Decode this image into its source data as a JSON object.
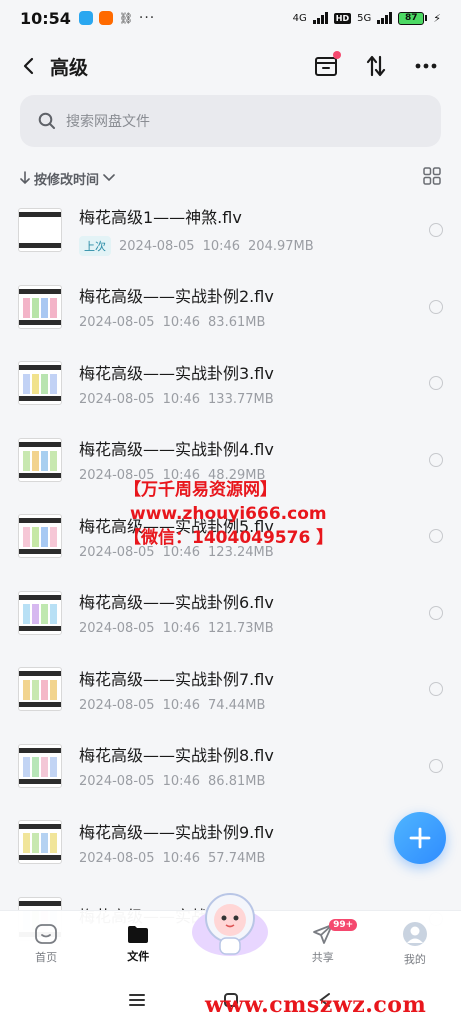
{
  "status_bar": {
    "time": "10:54",
    "network_1": "4G",
    "hd": "HD",
    "network_2": "5G",
    "battery": "87"
  },
  "header": {
    "title": "高级"
  },
  "search": {
    "placeholder": "搜索网盘文件"
  },
  "sort": {
    "label": "按修改时间"
  },
  "files": [
    {
      "name": "梅花高级1——神煞.flv",
      "badge": "上次",
      "date": "2024-08-05",
      "time": "10:46",
      "size": "204.97MB"
    },
    {
      "name": "梅花高级——实战卦例2.flv",
      "badge": "",
      "date": "2024-08-05",
      "time": "10:46",
      "size": "83.61MB"
    },
    {
      "name": "梅花高级——实战卦例3.flv",
      "badge": "",
      "date": "2024-08-05",
      "time": "10:46",
      "size": "133.77MB"
    },
    {
      "name": "梅花高级——实战卦例4.flv",
      "badge": "",
      "date": "2024-08-05",
      "time": "10:46",
      "size": "48.29MB"
    },
    {
      "name": "梅花高级——实战卦例5.flv",
      "badge": "",
      "date": "2024-08-05",
      "time": "10:46",
      "size": "123.24MB"
    },
    {
      "name": "梅花高级——实战卦例6.flv",
      "badge": "",
      "date": "2024-08-05",
      "time": "10:46",
      "size": "121.73MB"
    },
    {
      "name": "梅花高级——实战卦例7.flv",
      "badge": "",
      "date": "2024-08-05",
      "time": "10:46",
      "size": "74.44MB"
    },
    {
      "name": "梅花高级——实战卦例8.flv",
      "badge": "",
      "date": "2024-08-05",
      "time": "10:46",
      "size": "86.81MB"
    },
    {
      "name": "梅花高级——实战卦例9.flv",
      "badge": "",
      "date": "2024-08-05",
      "time": "10:46",
      "size": "57.74MB"
    },
    {
      "name": "梅花高级——实战",
      "badge": "",
      "date": "",
      "time": "",
      "size": ""
    }
  ],
  "watermark": {
    "line1": "【万千周易资源网】",
    "line2": "www.zhouyi666.com",
    "line3": "【微信：1404049576 】"
  },
  "bottom_nav": {
    "home": "首页",
    "files": "文件",
    "share": "共享",
    "share_badge": "99+",
    "mine": "我的"
  },
  "site_mark": "www.cmszwz.com",
  "colors": {
    "accent": "#2f8cff",
    "badge_red": "#f5486e",
    "watermark_red": "#e8161c"
  }
}
